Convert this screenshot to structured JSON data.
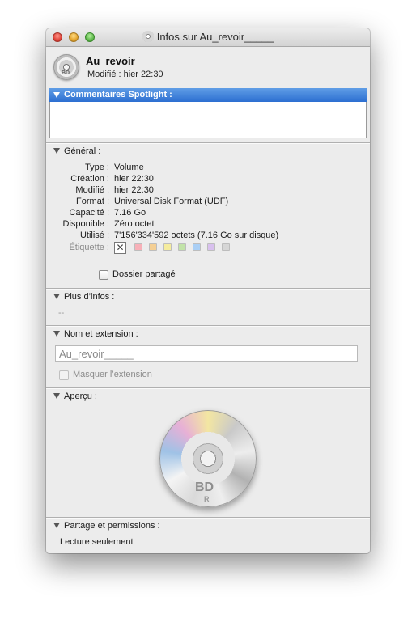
{
  "window": {
    "title": "Infos sur Au_revoir_____"
  },
  "header": {
    "name": "Au_revoir_____",
    "modified": "Modifié : hier 22:30",
    "icon_badge": "BD"
  },
  "spotlight": {
    "label": "Commentaires Spotlight :",
    "comment": ""
  },
  "general": {
    "label": "Général :",
    "rows": [
      {
        "key": "Type :",
        "value": "Volume"
      },
      {
        "key": "Création :",
        "value": "hier 22:30"
      },
      {
        "key": "Modifié :",
        "value": "hier 22:30"
      },
      {
        "key": "Format :",
        "value": "Universal Disk Format (UDF)"
      },
      {
        "key": "Capacité :",
        "value": "7.16 Go"
      },
      {
        "key": "Disponible :",
        "value": "Zéro octet"
      },
      {
        "key": "Utilisé :",
        "value": "7'156'334'592 octets (7.16 Go sur disque)"
      }
    ],
    "tag_label": "Étiquette :",
    "tag_none_glyph": "✕",
    "tag_colors": [
      "#f7b0b8",
      "#f4cf94",
      "#f5ec9e",
      "#c2e3a8",
      "#aacff5",
      "#d8c0ee",
      "#d6d6d6"
    ],
    "shared_folder_label": "Dossier partagé",
    "shared_folder_checked": false
  },
  "more_info": {
    "label": "Plus d’infos :",
    "value": "--"
  },
  "name_ext": {
    "label": "Nom et extension :",
    "field_value": "Au_revoir_____",
    "hide_ext_label": "Masquer l’extension",
    "hide_ext_checked": false
  },
  "preview": {
    "label": "Aperçu :",
    "disc_label": "BD",
    "disc_sub": "R"
  },
  "sharing": {
    "label": "Partage et permissions :",
    "value": "Lecture seulement"
  },
  "colors": {
    "selection_blue": "#2c6fd1",
    "window_bg": "#ececec"
  }
}
